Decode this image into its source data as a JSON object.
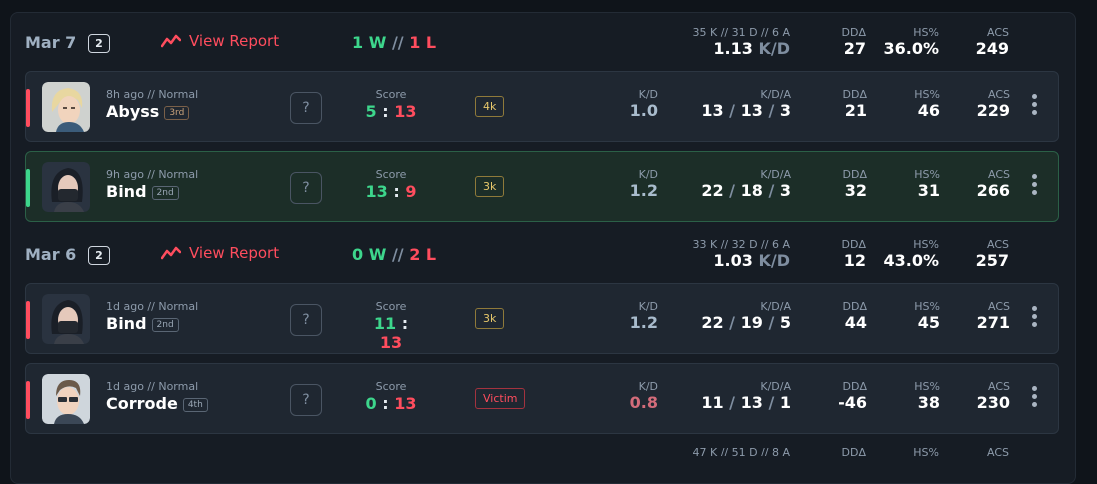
{
  "colors": {
    "win": "#3dd68c",
    "loss": "#ff4d5e",
    "accent": "#ff4d5e"
  },
  "days": [
    {
      "date": "Mar 7",
      "count": "2",
      "report_label": "View Report",
      "wins": "1 W",
      "sep": "//",
      "losses": "1 L",
      "kda_summary": "35 K // 31 D // 6 A",
      "kd_value": "1.13",
      "kd_unit": "K/D",
      "dd_label": "DDΔ",
      "dd": "27",
      "hs_label": "HS%",
      "hs": "36.0%",
      "acs_label": "ACS",
      "acs": "249"
    },
    {
      "date": "Mar 6",
      "count": "2",
      "report_label": "View Report",
      "wins": "0 W",
      "sep": "//",
      "losses": "2 L",
      "kda_summary": "33 K // 32 D // 6 A",
      "kd_value": "1.03",
      "kd_unit": "K/D",
      "dd_label": "DDΔ",
      "dd": "12",
      "hs_label": "HS%",
      "hs": "43.0%",
      "acs_label": "ACS",
      "acs": "257"
    },
    {
      "date": "",
      "count": "",
      "report_label": "",
      "wins": "",
      "sep": "",
      "losses": "",
      "kda_summary": "47 K // 51 D // 8 A",
      "kd_value": "",
      "kd_unit": "",
      "dd_label": "DDΔ",
      "dd": "",
      "hs_label": "HS%",
      "hs": "",
      "acs_label": "ACS",
      "acs": ""
    }
  ],
  "matches": [
    {
      "result": "loss",
      "agent_icon": "agent-portrait-blonde",
      "ago": "8h ago // Normal",
      "map": "Abyss",
      "place": "3rd",
      "unknown": "?",
      "score_label": "Score",
      "score_a": "5",
      "score_sep": ":",
      "score_b": "13",
      "badge": "4k",
      "kd_label": "K/D",
      "kd": "1.0",
      "kda_label": "K/D/A",
      "k": "13",
      "d": "13",
      "a": "3",
      "dd_label": "DDΔ",
      "dd": "21",
      "hs_label": "HS%",
      "hs": "46",
      "acs_label": "ACS",
      "acs": "229"
    },
    {
      "result": "win",
      "agent_icon": "agent-portrait-masked",
      "ago": "9h ago // Normal",
      "map": "Bind",
      "place": "2nd",
      "unknown": "?",
      "score_label": "Score",
      "score_a": "13",
      "score_sep": ":",
      "score_b": "9",
      "badge": "3k",
      "kd_label": "K/D",
      "kd": "1.2",
      "kda_label": "K/D/A",
      "k": "22",
      "d": "18",
      "a": "3",
      "dd_label": "DDΔ",
      "dd": "32",
      "hs_label": "HS%",
      "hs": "31",
      "acs_label": "ACS",
      "acs": "266"
    },
    {
      "result": "loss",
      "agent_icon": "agent-portrait-masked",
      "ago": "1d ago // Normal",
      "map": "Bind",
      "place": "2nd",
      "unknown": "?",
      "score_label": "Score",
      "score_a": "11",
      "score_sep": ":",
      "score_b": "13",
      "badge": "3k",
      "kd_label": "K/D",
      "kd": "1.2",
      "kda_label": "K/D/A",
      "k": "22",
      "d": "19",
      "a": "5",
      "dd_label": "DDΔ",
      "dd": "44",
      "hs_label": "HS%",
      "hs": "45",
      "acs_label": "ACS",
      "acs": "271"
    },
    {
      "result": "loss",
      "agent_icon": "agent-portrait-glasses",
      "ago": "1d ago // Normal",
      "map": "Corrode",
      "place": "4th",
      "unknown": "?",
      "score_label": "Score",
      "score_a": "0",
      "score_sep": ":",
      "score_b": "13",
      "badge": "Victim",
      "kd_label": "K/D",
      "kd": "0.8",
      "kda_label": "K/D/A",
      "k": "11",
      "d": "13",
      "a": "1",
      "dd_label": "DDΔ",
      "dd": "-46",
      "hs_label": "HS%",
      "hs": "38",
      "acs_label": "ACS",
      "acs": "230"
    }
  ]
}
